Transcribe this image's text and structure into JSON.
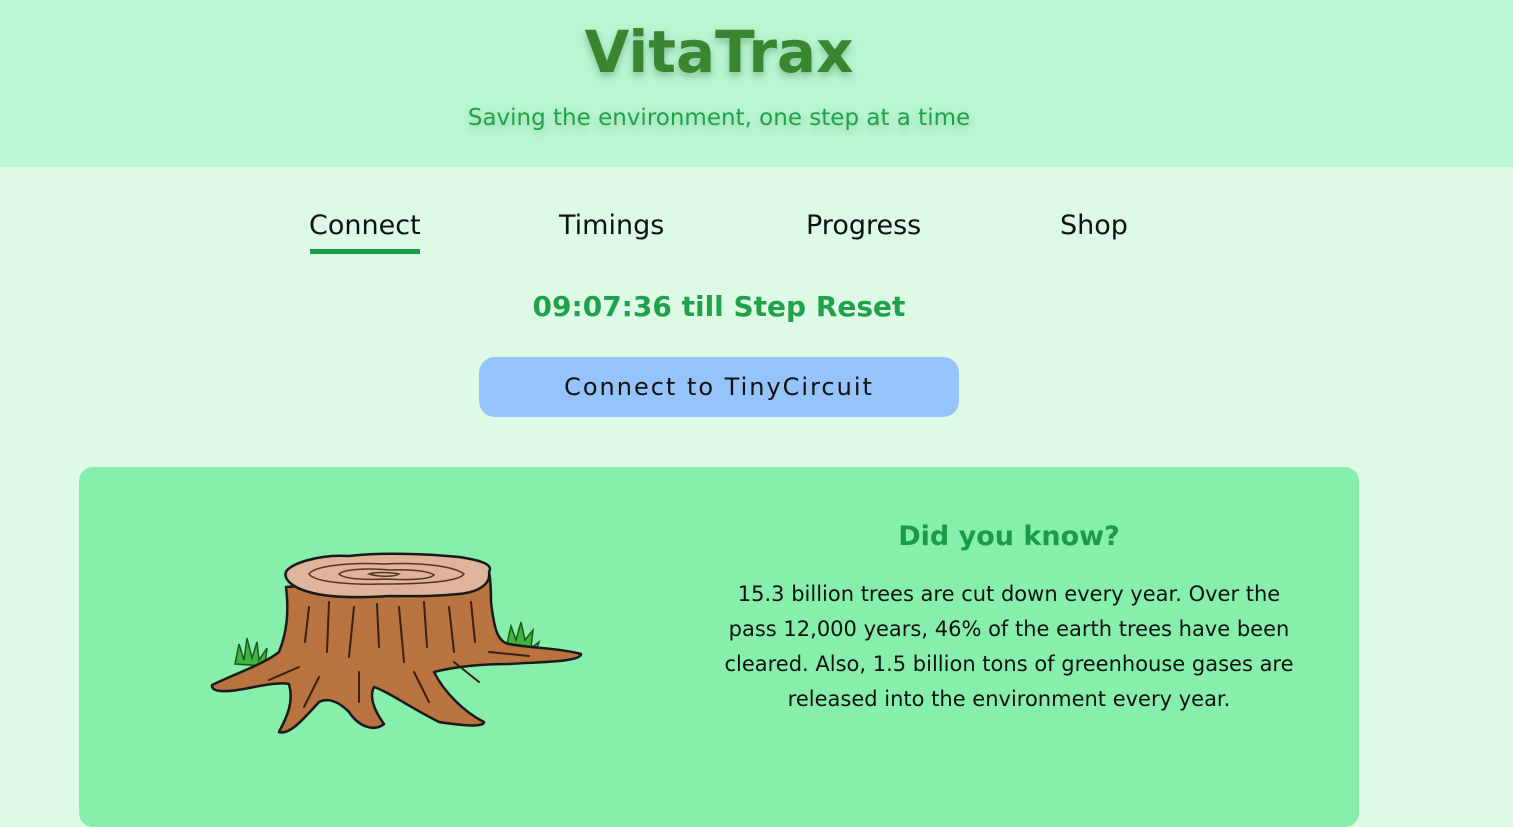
{
  "header": {
    "title": "VitaTrax",
    "tagline": "Saving the environment, one step at a time"
  },
  "nav": {
    "items": [
      {
        "label": "Connect",
        "active": true
      },
      {
        "label": "Timings",
        "active": false
      },
      {
        "label": "Progress",
        "active": false
      },
      {
        "label": "Shop",
        "active": false
      }
    ]
  },
  "timer": {
    "text": "09:07:36 till Step Reset"
  },
  "connect_button": {
    "label": "Connect to TinyCircuit"
  },
  "fact": {
    "title": "Did you know?",
    "text": "15.3 billion trees are cut down every year. Over the pass 12,000 years, 46% of the earth trees have been cleared. Also, 1.5 billion tons of greenhouse gases are released into the environment every year.",
    "image": "tree-stump-illustration"
  },
  "colors": {
    "header_bg": "#b9f7d3",
    "page_bg": "#dcfae6",
    "brand": "#3a8630",
    "accent": "#1fa24a",
    "button": "#94c4fb",
    "card": "#87efac"
  }
}
